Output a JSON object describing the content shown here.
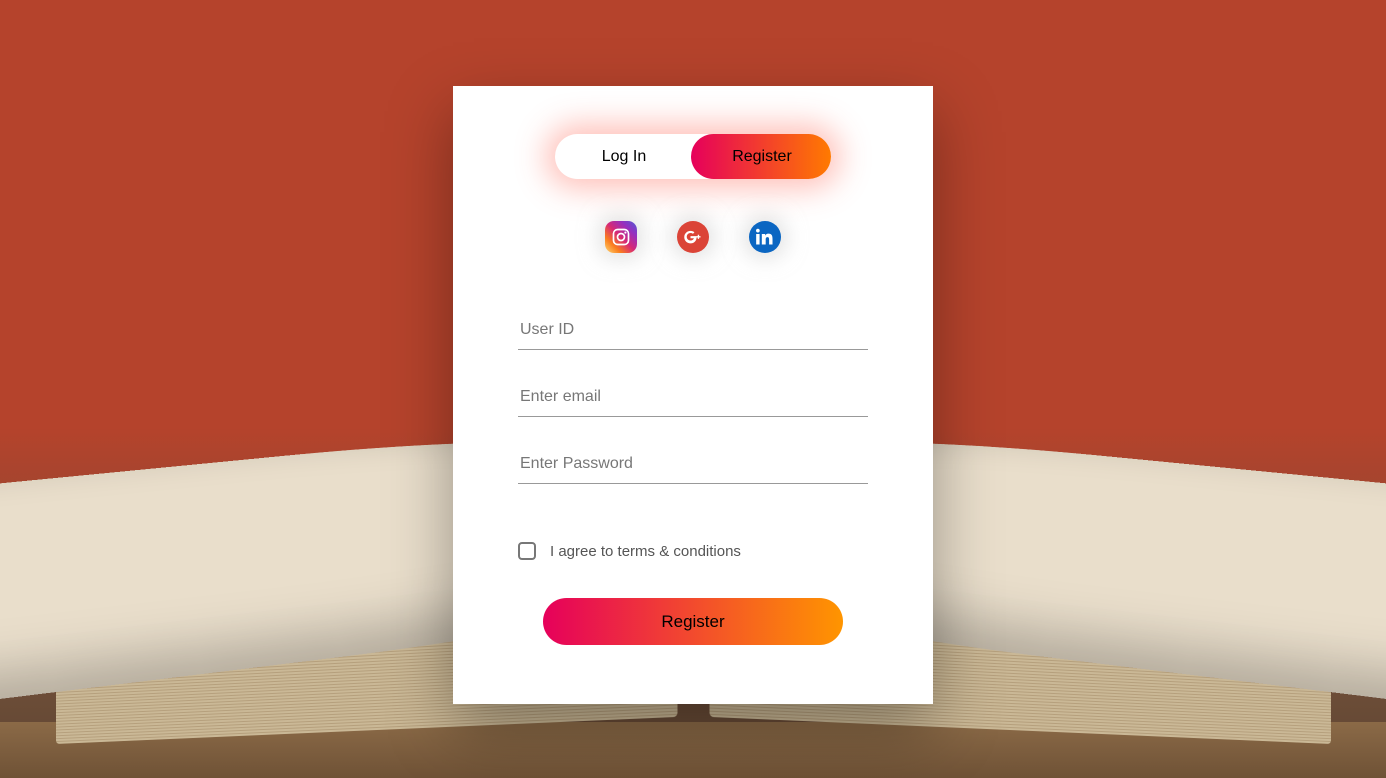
{
  "toggle": {
    "login": "Log In",
    "register": "Register"
  },
  "fields": {
    "userid_placeholder": "User ID",
    "email_placeholder": "Enter email",
    "password_placeholder": "Enter Password"
  },
  "terms_label": "I agree to terms & conditions",
  "submit_label": "Register",
  "social": {
    "instagram": "instagram-icon",
    "googleplus": "googleplus-icon",
    "linkedin": "linkedin-icon"
  }
}
